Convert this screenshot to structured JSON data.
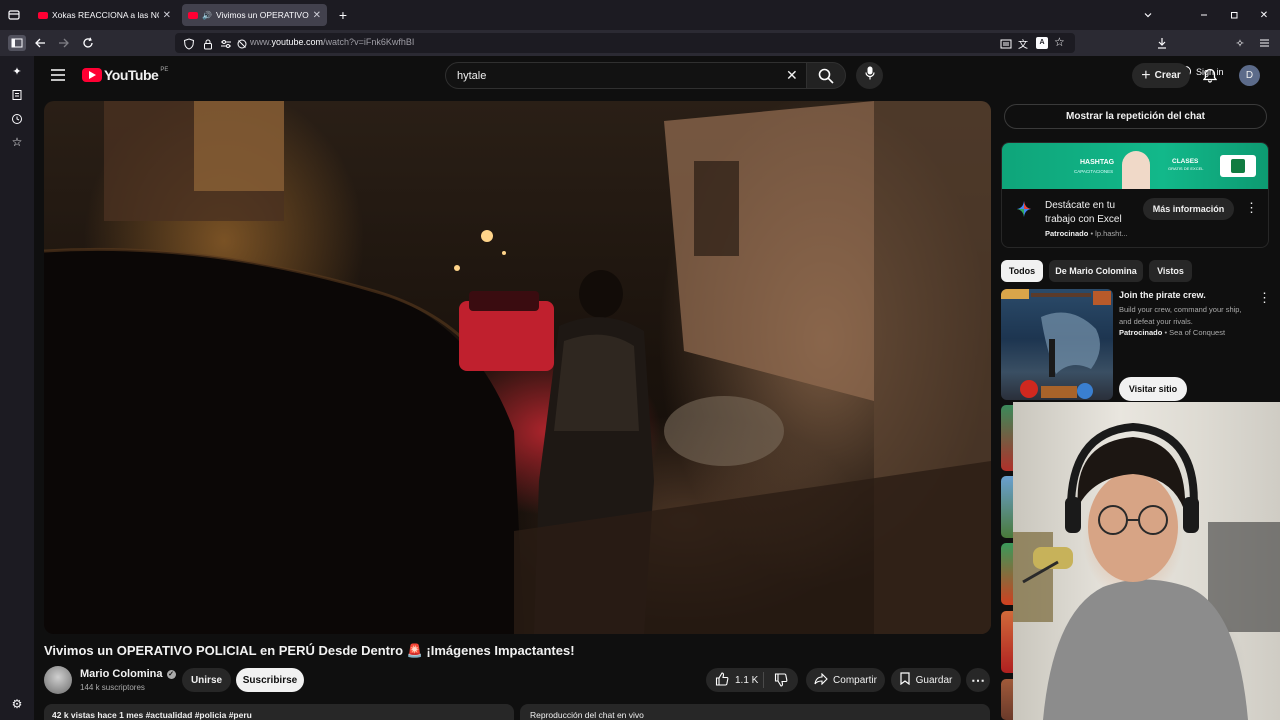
{
  "browser": {
    "tabs": [
      {
        "title": "Xokas REACCIONA a las NOVEDADES de Hytale",
        "active": false
      },
      {
        "title": "Vivimos un OPERATIVO POLICIAL",
        "active": true
      }
    ],
    "url_prefix": "www.",
    "url_domain": "youtube.com",
    "url_path": "/watch?v=iFnk6KwfhBI",
    "sign_in_label": "Sign in"
  },
  "youtube": {
    "logo_text": "YouTube",
    "country_code": "PE",
    "search_value": "hytale",
    "create_label": "Crear",
    "avatar_letter": "D"
  },
  "video": {
    "title": "Vivimos un OPERATIVO POLICIAL en PERÚ Desde Dentro 🚨 ¡Imágenes Impactantes!",
    "channel_name": "Mario Colomina",
    "subscribers": "144 k suscriptores",
    "join_label": "Unirse",
    "subscribe_label": "Suscribirse",
    "likes": "1.1 K",
    "share_label": "Compartir",
    "save_label": "Guardar",
    "description_preview": "42 k vistas  hace 1 mes  #actualidad #policia #peru",
    "chat_replay_preview": "Reproducción del chat en vivo"
  },
  "sidebar_right": {
    "chat_replay_button": "Mostrar la repetición del chat",
    "ad": {
      "banner_brand": "HASHTAG",
      "banner_sub": "CAPACITACIONES",
      "banner_tag": "CLASES",
      "banner_tag_sub": "GRATIS DE EXCEL",
      "title": "Destácate en tu trabajo con Excel",
      "sponsored": "Patrocinado",
      "domain": "lp.hasht...",
      "cta": "Más información"
    },
    "filters": [
      "Todos",
      "De Mario Colomina",
      "Vistos"
    ],
    "active_filter": 0,
    "promo": {
      "title": "Join the pirate crew.",
      "description": "Build your crew, command your ship, and defeat your rivals.",
      "sponsored": "Patrocinado",
      "advertiser": "Sea of Conquest",
      "cta": "Visitar sitio"
    }
  },
  "colors": {
    "yt_red": "#ff0033",
    "background": "#0f0f0f",
    "chip": "#272727"
  }
}
